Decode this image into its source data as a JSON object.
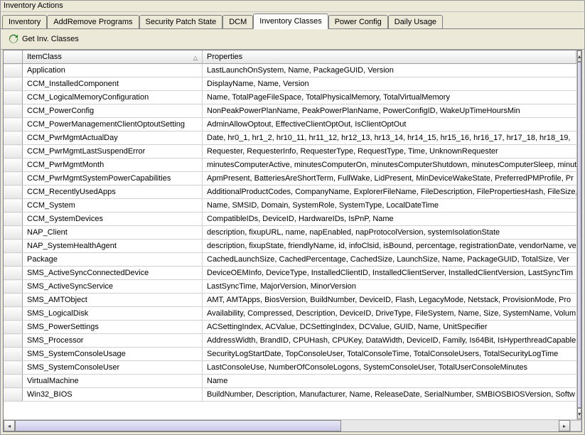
{
  "window": {
    "title": "Inventory Actions"
  },
  "tabs": [
    {
      "label": "Inventory",
      "active": false
    },
    {
      "label": "AddRemove Programs",
      "active": false
    },
    {
      "label": "Security Patch State",
      "active": false
    },
    {
      "label": "DCM",
      "active": false
    },
    {
      "label": "Inventory Classes",
      "active": true
    },
    {
      "label": "Power Config",
      "active": false
    },
    {
      "label": "Daily Usage",
      "active": false
    }
  ],
  "toolbar": {
    "get_inv_classes_label": "Get Inv. Classes"
  },
  "grid": {
    "columns": {
      "itemclass": "ItemClass",
      "properties": "Properties"
    },
    "rows": [
      {
        "cls": "Application",
        "props": "LastLaunchOnSystem, Name, PackageGUID, Version"
      },
      {
        "cls": "CCM_InstalledComponent",
        "props": "DisplayName, Name, Version"
      },
      {
        "cls": "CCM_LogicalMemoryConfiguration",
        "props": "Name, TotalPageFileSpace, TotalPhysicalMemory, TotalVirtualMemory"
      },
      {
        "cls": "CCM_PowerConfig",
        "props": "NonPeakPowerPlanName, PeakPowerPlanName, PowerConfigID, WakeUpTimeHoursMin"
      },
      {
        "cls": "CCM_PowerManagementClientOptoutSetting",
        "props": "AdminAllowOptout, EffectiveClientOptOut, IsClientOptOut"
      },
      {
        "cls": "CCM_PwrMgmtActualDay",
        "props": "Date, hr0_1, hr1_2, hr10_11, hr11_12, hr12_13, hr13_14, hr14_15, hr15_16, hr16_17, hr17_18, hr18_19,"
      },
      {
        "cls": "CCM_PwrMgmtLastSuspendError",
        "props": "Requester, RequesterInfo, RequesterType, RequestType, Time, UnknownRequester"
      },
      {
        "cls": "CCM_PwrMgmtMonth",
        "props": "minutesComputerActive, minutesComputerOn, minutesComputerShutdown, minutesComputerSleep, minute"
      },
      {
        "cls": "CCM_PwrMgmtSystemPowerCapabilities",
        "props": "ApmPresent, BatteriesAreShortTerm, FullWake, LidPresent, MinDeviceWakeState, PreferredPMProfile, Pr"
      },
      {
        "cls": "CCM_RecentlyUsedApps",
        "props": "AdditionalProductCodes, CompanyName, ExplorerFileName, FileDescription, FilePropertiesHash, FileSize, "
      },
      {
        "cls": "CCM_System",
        "props": "Name, SMSID, Domain, SystemRole, SystemType, LocalDateTime"
      },
      {
        "cls": "CCM_SystemDevices",
        "props": "CompatibleIDs, DeviceID, HardwareIDs, IsPnP, Name"
      },
      {
        "cls": "NAP_Client",
        "props": "description, fixupURL, name, napEnabled, napProtocolVersion, systemIsolationState"
      },
      {
        "cls": "NAP_SystemHealthAgent",
        "props": "description, fixupState, friendlyName, id, infoClsid, isBound, percentage, registrationDate, vendorName, ve"
      },
      {
        "cls": "Package",
        "props": "CachedLaunchSize, CachedPercentage, CachedSize, LaunchSize, Name, PackageGUID, TotalSize, Ver"
      },
      {
        "cls": "SMS_ActiveSyncConnectedDevice",
        "props": "DeviceOEMInfo, DeviceType, InstalledClientID, InstalledClientServer, InstalledClientVersion, LastSyncTim"
      },
      {
        "cls": "SMS_ActiveSyncService",
        "props": "LastSyncTime, MajorVersion, MinorVersion"
      },
      {
        "cls": "SMS_AMTObject",
        "props": "AMT, AMTApps, BiosVersion, BuildNumber, DeviceID, Flash, LegacyMode, Netstack, ProvisionMode, Pro"
      },
      {
        "cls": "SMS_LogicalDisk",
        "props": "Availability, Compressed, Description, DeviceID, DriveType, FileSystem, Name, Size, SystemName, Volum"
      },
      {
        "cls": "SMS_PowerSettings",
        "props": "ACSettingIndex, ACValue, DCSettingIndex, DCValue, GUID, Name, UnitSpecifier"
      },
      {
        "cls": "SMS_Processor",
        "props": "AddressWidth, BrandID, CPUHash, CPUKey, DataWidth, DeviceID, Family, Is64Bit, IsHyperthreadCapable"
      },
      {
        "cls": "SMS_SystemConsoleUsage",
        "props": "SecurityLogStartDate, TopConsoleUser, TotalConsoleTime, TotalConsoleUsers, TotalSecurityLogTime"
      },
      {
        "cls": "SMS_SystemConsoleUser",
        "props": "LastConsoleUse, NumberOfConsoleLogons, SystemConsoleUser, TotalUserConsoleMinutes"
      },
      {
        "cls": "VirtualMachine",
        "props": "Name"
      },
      {
        "cls": "Win32_BIOS",
        "props": "BuildNumber, Description, Manufacturer, Name, ReleaseDate, SerialNumber, SMBIOSBIOSVersion, Softw"
      }
    ]
  }
}
